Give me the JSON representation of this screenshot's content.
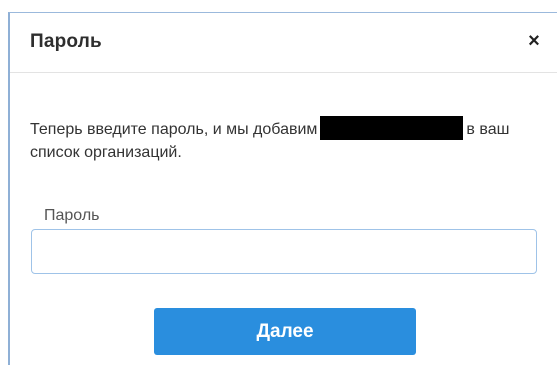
{
  "dialog": {
    "title": "Пароль",
    "close_icon": "×"
  },
  "message": {
    "text_before": "Теперь введите пароль, и мы добавим",
    "text_after": "в ваш список организаций."
  },
  "password": {
    "label": "Пароль",
    "value": "",
    "placeholder": ""
  },
  "buttons": {
    "next_label": "Далее"
  },
  "colors": {
    "accent": "#2a8ede",
    "input_border": "#9fc3e8"
  }
}
